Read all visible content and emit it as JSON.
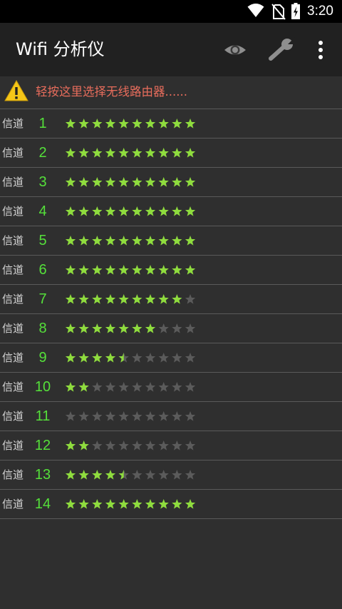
{
  "status_bar": {
    "time": "3:20",
    "icons": [
      "wifi-icon",
      "no-sim-icon",
      "battery-charging-icon"
    ]
  },
  "app_bar": {
    "title": "Wifi 分析仪",
    "actions": [
      "eye-icon",
      "wrench-icon",
      "more-vert-icon"
    ]
  },
  "warning": {
    "icon": "warning-icon",
    "text": "轻按这里选择无线路由器......"
  },
  "colors": {
    "star_on": "#8fdc3e",
    "star_off": "#5b5b5b",
    "channel_number": "#55e03a",
    "warning_text": "#e86d5c"
  },
  "star_max": 10,
  "channels": [
    {
      "label": "信道",
      "number": "1",
      "rating": 10
    },
    {
      "label": "信道",
      "number": "2",
      "rating": 10
    },
    {
      "label": "信道",
      "number": "3",
      "rating": 10
    },
    {
      "label": "信道",
      "number": "4",
      "rating": 10
    },
    {
      "label": "信道",
      "number": "5",
      "rating": 10
    },
    {
      "label": "信道",
      "number": "6",
      "rating": 10
    },
    {
      "label": "信道",
      "number": "7",
      "rating": 9
    },
    {
      "label": "信道",
      "number": "8",
      "rating": 7
    },
    {
      "label": "信道",
      "number": "9",
      "rating": 4.5
    },
    {
      "label": "信道",
      "number": "10",
      "rating": 2
    },
    {
      "label": "信道",
      "number": "11",
      "rating": 0
    },
    {
      "label": "信道",
      "number": "12",
      "rating": 2
    },
    {
      "label": "信道",
      "number": "13",
      "rating": 4.5
    },
    {
      "label": "信道",
      "number": "14",
      "rating": 10
    }
  ]
}
